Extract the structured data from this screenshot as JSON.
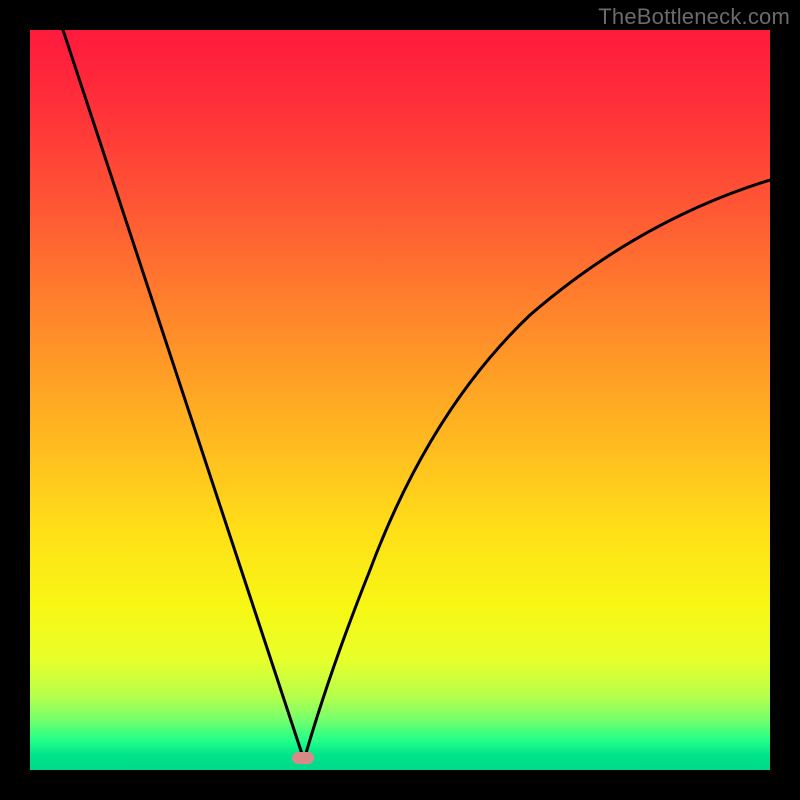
{
  "watermark": "TheBottleneck.com",
  "marker": {
    "x_frac": 0.37,
    "y_frac": 0.985
  },
  "chart_data": {
    "type": "line",
    "title": "",
    "xlabel": "",
    "ylabel": "",
    "xlim": [
      0,
      1
    ],
    "ylim": [
      0,
      1
    ],
    "series": [
      {
        "name": "left-branch",
        "x": [
          0.045,
          0.09,
          0.14,
          0.19,
          0.24,
          0.29,
          0.33,
          0.355,
          0.37
        ],
        "y": [
          1.0,
          0.86,
          0.71,
          0.56,
          0.41,
          0.26,
          0.12,
          0.04,
          0.0
        ]
      },
      {
        "name": "right-branch",
        "x": [
          0.37,
          0.4,
          0.44,
          0.49,
          0.55,
          0.62,
          0.7,
          0.79,
          0.89,
          1.0
        ],
        "y": [
          0.0,
          0.09,
          0.21,
          0.34,
          0.46,
          0.56,
          0.64,
          0.71,
          0.76,
          0.8
        ]
      }
    ],
    "optimum_marker": {
      "x": 0.37,
      "y": 0.0
    },
    "background_gradient": {
      "top_color": "#ff1a3c",
      "bottom_color": "#00d98a"
    }
  }
}
